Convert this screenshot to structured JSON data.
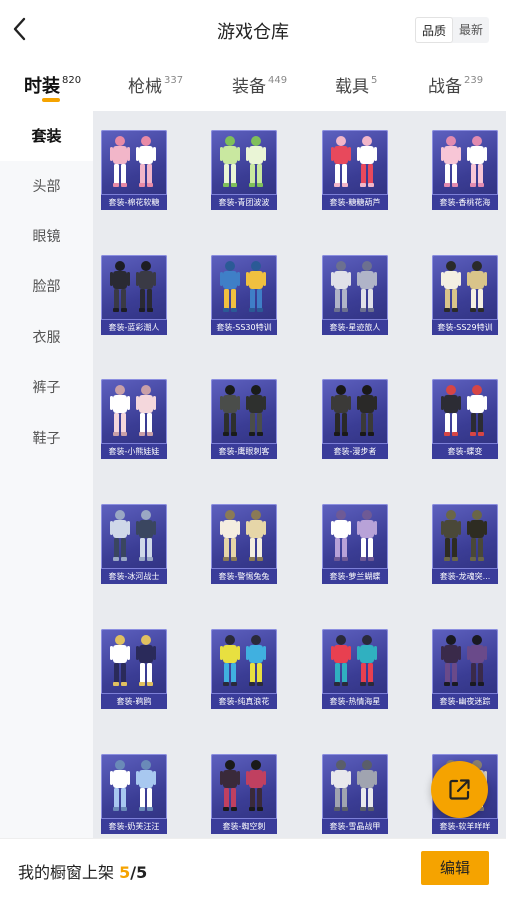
{
  "header": {
    "title": "游戏仓库",
    "back_icon": "chevron-left-icon"
  },
  "sort": {
    "quality": "品质",
    "latest": "最新"
  },
  "tabs": [
    {
      "label": "时装",
      "count": "820"
    },
    {
      "label": "枪械",
      "count": "337"
    },
    {
      "label": "装备",
      "count": "449"
    },
    {
      "label": "载具",
      "count": "5"
    },
    {
      "label": "战备",
      "count": "239"
    }
  ],
  "sidebar": {
    "items": [
      "套装",
      "头部",
      "眼镜",
      "脸部",
      "衣服",
      "裤子",
      "鞋子"
    ]
  },
  "items": [
    {
      "name": "套装-棉花软糖",
      "c1": "#f2b6c9",
      "c2": "#ffffff",
      "c3": "#e88aa6"
    },
    {
      "name": "套装-青团波波",
      "c1": "#c9e8a0",
      "c2": "#eaf5d6",
      "c3": "#7fbf5a"
    },
    {
      "name": "套装-糖糖葫芦",
      "c1": "#e8495c",
      "c2": "#ffffff",
      "c3": "#f2b6c9"
    },
    {
      "name": "套装-香桃花海",
      "c1": "#f7c6d6",
      "c2": "#ffffff",
      "c3": "#e28bb0"
    },
    {
      "name": "套装-蓝彩潮人",
      "c1": "#2a2a33",
      "c2": "#3a3a45",
      "c3": "#1d1d24"
    },
    {
      "name": "套装-SS30特训",
      "c1": "#3f7fc7",
      "c2": "#f0c040",
      "c3": "#2b5a96"
    },
    {
      "name": "套装-星迹旅人",
      "c1": "#e0e0e8",
      "c2": "#b0b4c8",
      "c3": "#6c7090"
    },
    {
      "name": "套装-SS29特训",
      "c1": "#f4efe2",
      "c2": "#d9c48a",
      "c3": "#2a2a2a"
    },
    {
      "name": "套装-小熊娃娃",
      "c1": "#ffffff",
      "c2": "#f4d7dc",
      "c3": "#c9a0a8"
    },
    {
      "name": "套装-鹰眼刺客",
      "c1": "#4a4d4a",
      "c2": "#2e302e",
      "c3": "#1a1c1a"
    },
    {
      "name": "套装-漫步者",
      "c1": "#3b3a38",
      "c2": "#2a2928",
      "c3": "#1a1918"
    },
    {
      "name": "套装-蝶变",
      "c1": "#2c2c34",
      "c2": "#ffffff",
      "c3": "#d64545"
    },
    {
      "name": "套装-冰河战士",
      "c1": "#cfd8e8",
      "c2": "#3a4660",
      "c3": "#9aa8c4"
    },
    {
      "name": "套装-警惕兔兔",
      "c1": "#f4eee0",
      "c2": "#e6d6a8",
      "c3": "#8a7a56"
    },
    {
      "name": "套装-萝兰蝴蝶",
      "c1": "#ffffff",
      "c2": "#b8a2d8",
      "c3": "#6e5a96"
    },
    {
      "name": "套装-龙魂突...",
      "c1": "#4a4838",
      "c2": "#2e2c22",
      "c3": "#6a6648"
    },
    {
      "name": "套装-鹈鸥",
      "c1": "#ffffff",
      "c2": "#2a2a5a",
      "c3": "#e0c060"
    },
    {
      "name": "套装-纯真浪花",
      "c1": "#e8e040",
      "c2": "#40b0e0",
      "c3": "#2a2a3a"
    },
    {
      "name": "套装-热情海星",
      "c1": "#e84050",
      "c2": "#30b0c0",
      "c3": "#2a2a3a"
    },
    {
      "name": "套装-幽夜迷踪",
      "c1": "#3a2a4a",
      "c2": "#6a4a8a",
      "c3": "#1a1a22"
    },
    {
      "name": "套装-奶芙汪汪",
      "c1": "#ffffff",
      "c2": "#a8c8f0",
      "c3": "#6a8ab8"
    },
    {
      "name": "套装-蜘空刺",
      "c1": "#3a2a3a",
      "c2": "#c04060",
      "c3": "#1a1a1a"
    },
    {
      "name": "套装-雪晶战甲",
      "c1": "#e8e8ec",
      "c2": "#a0a4b0",
      "c3": "#5a5e6a"
    },
    {
      "name": "套装-软羊咩咩",
      "c1": "#ffffff",
      "c2": "#d8d0c0",
      "c3": "#8a8070"
    }
  ],
  "fab": {
    "icon": "share-external-icon"
  },
  "bottom": {
    "shelf_label": "我的橱窗上架",
    "shelf_count": "5",
    "shelf_total": "/5",
    "edit_label": "编辑"
  },
  "colors": {
    "accent": "#f5a300",
    "card": "#3b3d95"
  }
}
